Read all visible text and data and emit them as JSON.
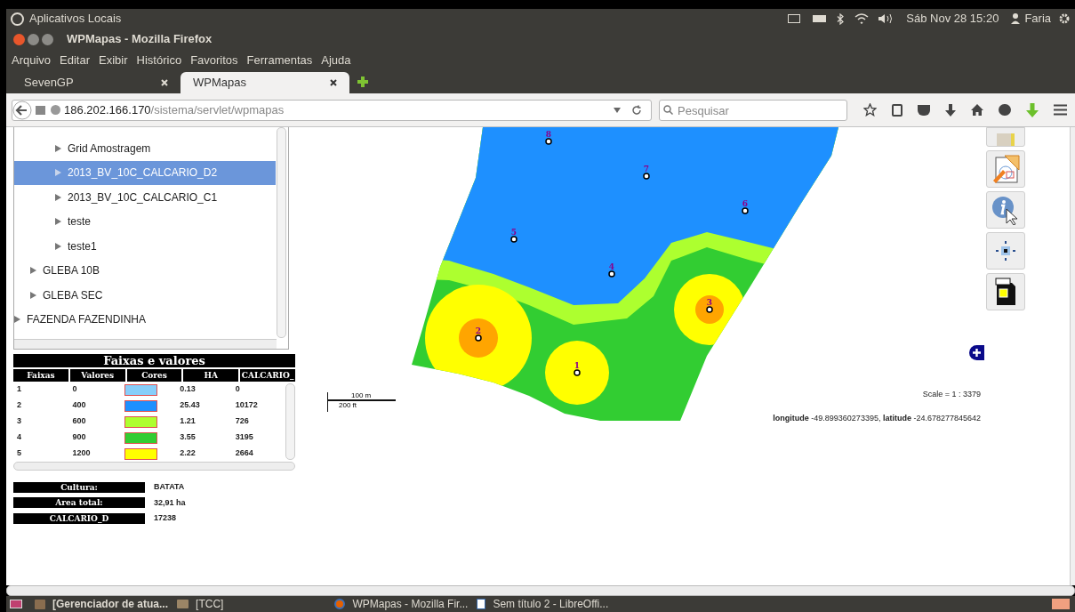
{
  "top_panel": {
    "title": "Aplicativos Locais",
    "clock": "Sáb Nov 28 15:20",
    "user": "Faria"
  },
  "window": {
    "title": "WPMapas - Mozilla Firefox"
  },
  "menu": [
    "Arquivo",
    "Editar",
    "Exibir",
    "Histórico",
    "Favoritos",
    "Ferramentas",
    "Ajuda"
  ],
  "tabs": [
    {
      "label": "SevenGP",
      "selected": false
    },
    {
      "label": "WPMapas",
      "selected": true
    }
  ],
  "address": {
    "host": "186.202.166.170",
    "path": "/sistema/servlet/wpmapas"
  },
  "search": {
    "placeholder": "Pesquisar"
  },
  "tree": [
    {
      "children": [
        {
          "children": [
            {
              "label": "Grid Amostragem",
              "selected": false
            },
            {
              "label": "2013_BV_10C_CALCARIO_D2",
              "selected": true
            },
            {
              "label": "2013_BV_10C_CALCARIO_C1",
              "selected": false
            },
            {
              "label": "teste",
              "selected": false
            },
            {
              "label": "teste1",
              "selected": false
            }
          ]
        },
        {
          "label": "GLEBA 10B",
          "selected": false
        },
        {
          "label": "GLEBA SEC",
          "selected": false
        }
      ]
    },
    {
      "label": "FAZENDA FAZENDINHA",
      "selected": false
    }
  ],
  "legend": {
    "title": "Faixas e valores",
    "columns": [
      "Faixas",
      "Valores",
      "Cores",
      "HA",
      "CALCARIO_"
    ],
    "rows": [
      {
        "band": "1",
        "value": "0",
        "color": "#87cefa",
        "ha": "0.13",
        "calcario": "0"
      },
      {
        "band": "2",
        "value": "400",
        "color": "#1e90ff",
        "ha": "25.43",
        "calcario": "10172"
      },
      {
        "band": "3",
        "value": "600",
        "color": "#adff2f",
        "ha": "1.21",
        "calcario": "726"
      },
      {
        "band": "4",
        "value": "900",
        "color": "#32cd32",
        "ha": "3.55",
        "calcario": "3195"
      },
      {
        "band": "5",
        "value": "1200",
        "color": "#ffff00",
        "ha": "2.22",
        "calcario": "2664"
      }
    ]
  },
  "summary": [
    {
      "label": "Cultura:",
      "value": "BATATA"
    },
    {
      "label": "Area total:",
      "value": "32,91 ha"
    },
    {
      "label": "CALCARIO_D",
      "value": "17238"
    }
  ],
  "map": {
    "points": [
      {
        "label": "1"
      },
      {
        "label": "2"
      },
      {
        "label": "3"
      },
      {
        "label": "4"
      },
      {
        "label": "5"
      },
      {
        "label": "6"
      },
      {
        "label": "7"
      },
      {
        "label": "8"
      }
    ],
    "scale_bar": {
      "metric": "100 m",
      "imperial": "200 ft"
    },
    "scale": "Scale = 1 : 3379",
    "coordinates": "**longitude** -49.899360273395, **latitude** -24.678277845642"
  },
  "taskbar": [
    {
      "label": "[Gerenciador de atua...",
      "kind": "box"
    },
    {
      "label": "[TCC]",
      "kind": "folder"
    },
    {
      "label": "WPMapas - Mozilla Fir...",
      "kind": "browser"
    },
    {
      "label": "Sem título 2 - LibreOffi...",
      "kind": "document"
    }
  ]
}
